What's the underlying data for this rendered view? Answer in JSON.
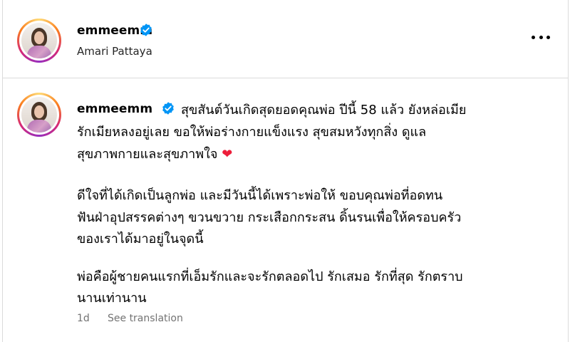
{
  "header": {
    "username": "emmeemm",
    "location": "Amari Pattaya",
    "verified_icon": "verified-badge-icon",
    "more_icon": "more-options-icon"
  },
  "caption": {
    "username": "emmeemm",
    "first_line": "สุขสันต์วันเกิดสุดยอดคุณพ่อ ปีนี้ 58 แล้ว ยังหล่อเมีย",
    "lines": [
      "รักเมียหลงอยู่เลย ขอให้พ่อร่างกายแข็งแรง สุขสมหวังทุกสิ่ง ดูแล",
      "สุขภาพกายและสุขภาพใจ",
      "ดีใจที่ได้เกิดเป็นลูกพ่อ และมีวันนี้ได้เพราะพ่อให้ ขอบคุณพ่อที่อดทน",
      "ฟันฝ่าอุปสรรคต่างๆ ขวนขวาย กระเสือกกระสน ดิ้นรนเพื่อให้ครอบครัว",
      "ของเราได้มาอยู่ในจุดนี้",
      "พ่อคือผู้ชายคนแรกที่เอ็มรักและจะรักตลอดไป รักเสมอ รักที่สุด รักตราบ",
      "นานเท่านาน"
    ],
    "emoji": "❤"
  },
  "meta": {
    "time": "1d",
    "translate_label": "See translation"
  },
  "colors": {
    "verified": "#0095f6",
    "heart": "#ed1e3a",
    "secondary_text": "#737373",
    "divider": "#dbdbdb"
  }
}
